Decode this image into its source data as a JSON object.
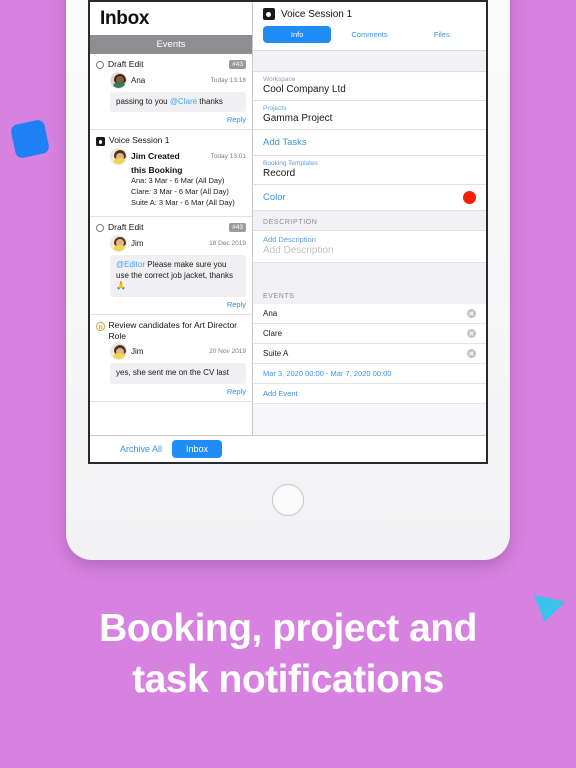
{
  "theme": {
    "background": "#d781e0",
    "accent_blue": "#1f8df5",
    "link_blue": "#3d93e8",
    "color_swatch": "#f51f08",
    "deco_square": "#1f7ff5",
    "deco_triangle": "#39c2ec"
  },
  "caption": {
    "line1": "Booking, project and",
    "line2": "task notifications"
  },
  "left_pane": {
    "title": "Inbox",
    "section_bar": "Events",
    "threads": [
      {
        "icon": "circle-outline-icon",
        "title": "Draft Edit",
        "badge": "#43",
        "author": "Ana",
        "author_bold": false,
        "time": "Today 13:18",
        "message_pre": "passing to you ",
        "mention": "@Clare",
        "message_post": "  thanks",
        "reply": "Reply"
      },
      {
        "icon": "calendar-icon",
        "title": "Voice Session 1",
        "badge": "",
        "author": "Jim Created",
        "author_bold": true,
        "created_line2": "this Booking",
        "time": "Today 13:01",
        "details": [
          "Ana: 3 Mar - 6 Mar (All Day)",
          "Clare: 3 Mar - 6 Mar (All Day)",
          "Suite A: 3 Mar - 6 Mar (All Day)"
        ]
      },
      {
        "icon": "circle-outline-icon",
        "title": "Draft Edit",
        "badge": "#43",
        "author": "Jim",
        "author_bold": false,
        "time": "18 Dec 2019",
        "mention": "@Editor",
        "message_post": " Please make sure you use the correct job jacket, thanks 🙏",
        "reply": "Reply"
      },
      {
        "icon": "pause-icon",
        "title": "Review candidates for Art Director Role",
        "badge": "",
        "author": "Jim",
        "author_bold": false,
        "time": "20 Nov 2019",
        "message_post": "yes, she sent me on the CV last",
        "reply": "Reply"
      }
    ]
  },
  "right_pane": {
    "title": "Voice Session 1",
    "title_icon": "calendar-icon",
    "tabs": [
      {
        "label": "Info",
        "active": true
      },
      {
        "label": "Comments",
        "active": false
      },
      {
        "label": "Files",
        "active": false
      }
    ],
    "fields": [
      {
        "label": "Workspace",
        "value": "Cool Company Ltd",
        "label_style": "gray"
      },
      {
        "label": "Projects",
        "value": "Gamma Project",
        "label_style": "blue"
      }
    ],
    "add_tasks_link": "Add Tasks",
    "booking_templates": {
      "label": "Booking Templates",
      "value": "Record"
    },
    "color_field": {
      "label": "Color",
      "swatch": "#f51f08"
    },
    "description": {
      "section_title": "DESCRIPTION",
      "link": "Add Description",
      "placeholder": "Add Description"
    },
    "events": {
      "section_title": "EVENTS",
      "rows": [
        {
          "name": "Ana",
          "remove_icon": "close-circle-icon"
        },
        {
          "name": "Clare",
          "remove_icon": "close-circle-icon"
        },
        {
          "name": "Suite A",
          "remove_icon": "close-circle-icon"
        }
      ],
      "date_range": "Mar 3, 2020 00:00 - Mar 7, 2020 00:00",
      "add_link": "Add Event"
    }
  },
  "bottom_bar": {
    "archive_label": "Archive All",
    "inbox_label": "Inbox"
  }
}
